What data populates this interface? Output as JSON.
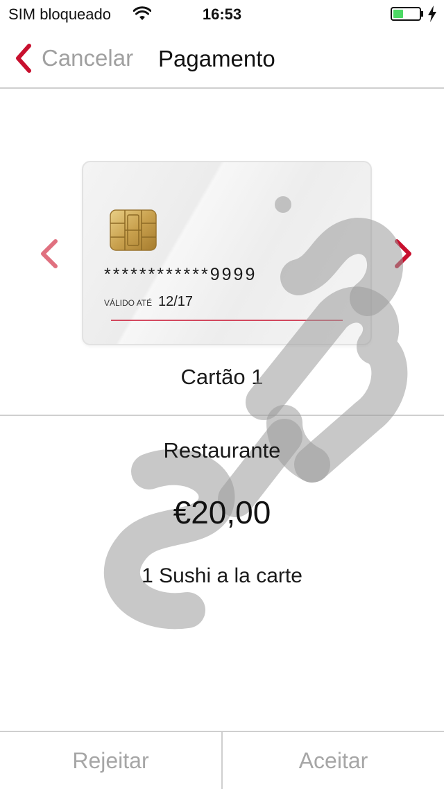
{
  "status_bar": {
    "carrier": "SIM bloqueado",
    "time": "16:53",
    "wifi_icon": "wifi-icon",
    "battery_icon": "battery-icon",
    "charging_icon": "charging-bolt-icon",
    "battery_color": "#4cd964"
  },
  "nav": {
    "back_label": "Cancelar",
    "title": "Pagamento",
    "accent": "#c8102e"
  },
  "card": {
    "number": "************9999",
    "valid_label": "VÁLIDO ATÉ",
    "valid_value": "12/17",
    "name": "Cartão 1"
  },
  "payment": {
    "merchant": "Restaurante",
    "amount": "€20,00",
    "description": "1 Sushi a la carte"
  },
  "watermark": "SIBS",
  "actions": {
    "reject_label": "Rejeitar",
    "accept_label": "Aceitar"
  }
}
